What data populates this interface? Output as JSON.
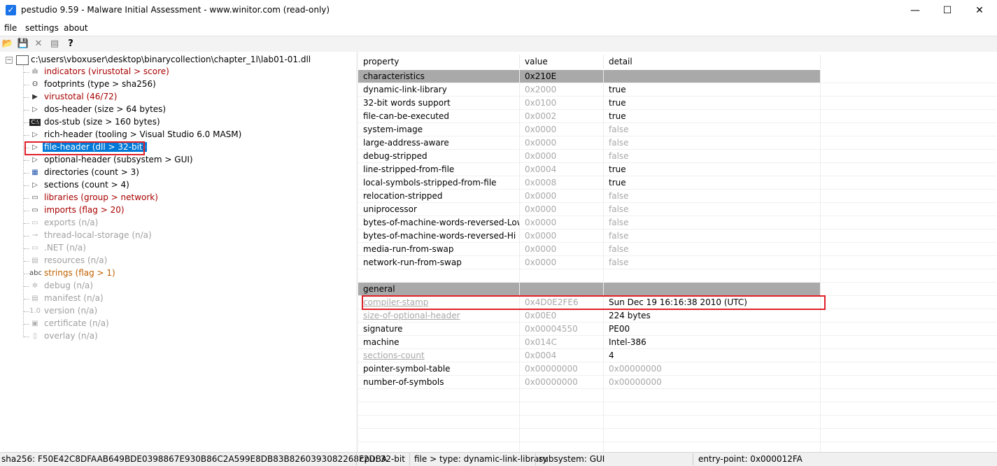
{
  "window": {
    "title": "pestudio 9.59 - Malware Initial Assessment - www.winitor.com (read-only)",
    "minimize": "—",
    "maximize": "☐",
    "close": "✕"
  },
  "menu": [
    "file",
    "settings",
    "about"
  ],
  "toolbar": {
    "icons": [
      "open-icon",
      "save-icon",
      "close-icon",
      "list-icon",
      "help-icon"
    ],
    "glyphs": [
      "📂",
      "💾",
      "✕",
      "▤",
      "?"
    ]
  },
  "tree": {
    "root": "c:\\users\\vboxuser\\desktop\\binarycollection\\chapter_1l\\lab01-01.dll",
    "expander": "−",
    "items": [
      {
        "label": "indicators (virustotal > score)",
        "style": "red",
        "icon": "indicators-icon",
        "glyph": "ılı"
      },
      {
        "label": "footprints (type > sha256)",
        "style": "normal",
        "icon": "footprints-icon",
        "glyph": "ʘ"
      },
      {
        "label": "virustotal (46/72)",
        "style": "red",
        "icon": "virustotal-icon",
        "glyph": "▶"
      },
      {
        "label": "dos-header (size > 64 bytes)",
        "style": "normal",
        "icon": "arrow-icon",
        "glyph": "▷"
      },
      {
        "label": "dos-stub (size > 160 bytes)",
        "style": "normal",
        "icon": "console-icon",
        "glyph": "C:\\"
      },
      {
        "label": "rich-header (tooling > Visual Studio 6.0 MASM)",
        "style": "normal",
        "icon": "arrow-icon",
        "glyph": "▷"
      },
      {
        "label": "file-header (dll > 32-bit)",
        "style": "selected",
        "icon": "arrow-icon",
        "glyph": "▷"
      },
      {
        "label": "optional-header (subsystem > GUI)",
        "style": "normal",
        "icon": "arrow-icon",
        "glyph": "▷"
      },
      {
        "label": "directories (count > 3)",
        "style": "normal",
        "icon": "directories-icon",
        "glyph": "▦"
      },
      {
        "label": "sections (count > 4)",
        "style": "normal",
        "icon": "arrow-icon",
        "glyph": "▷"
      },
      {
        "label": "libraries (group > network)",
        "style": "red",
        "icon": "libraries-icon",
        "glyph": "▭"
      },
      {
        "label": "imports (flag > 20)",
        "style": "red",
        "icon": "imports-icon",
        "glyph": "▭"
      },
      {
        "label": "exports (n/a)",
        "style": "gray",
        "icon": "exports-icon",
        "glyph": "▭"
      },
      {
        "label": "thread-local-storage (n/a)",
        "style": "gray",
        "icon": "tls-icon",
        "glyph": "⊸"
      },
      {
        "label": ".NET (n/a)",
        "style": "gray",
        "icon": "dotnet-icon",
        "glyph": "▭"
      },
      {
        "label": "resources (n/a)",
        "style": "gray",
        "icon": "resources-icon",
        "glyph": "▤"
      },
      {
        "label": "strings (flag > 1)",
        "style": "orange",
        "icon": "strings-icon",
        "glyph": "abc"
      },
      {
        "label": "debug (n/a)",
        "style": "gray",
        "icon": "debug-icon",
        "glyph": "✲"
      },
      {
        "label": "manifest (n/a)",
        "style": "gray",
        "icon": "manifest-icon",
        "glyph": "▤"
      },
      {
        "label": "version (n/a)",
        "style": "gray",
        "icon": "version-icon",
        "glyph": "1.0"
      },
      {
        "label": "certificate (n/a)",
        "style": "gray",
        "icon": "certificate-icon",
        "glyph": "▣"
      },
      {
        "label": "overlay (n/a)",
        "style": "gray",
        "icon": "overlay-icon",
        "glyph": "▯"
      }
    ]
  },
  "grid": {
    "headers": [
      "property",
      "value",
      "detail"
    ],
    "rows": [
      {
        "kind": "group",
        "property": "characteristics",
        "value": "0x210E",
        "detail": ""
      },
      {
        "property": "dynamic-link-library",
        "value": "0x2000",
        "detail": "true",
        "vdim": true
      },
      {
        "property": "32-bit words support",
        "value": "0x0100",
        "detail": "true",
        "vdim": true
      },
      {
        "property": "file-can-be-executed",
        "value": "0x0002",
        "detail": "true",
        "vdim": true
      },
      {
        "property": "system-image",
        "value": "0x0000",
        "detail": "false",
        "vdim": true,
        "ddim": true
      },
      {
        "property": "large-address-aware",
        "value": "0x0000",
        "detail": "false",
        "vdim": true,
        "ddim": true
      },
      {
        "property": "debug-stripped",
        "value": "0x0000",
        "detail": "false",
        "vdim": true,
        "ddim": true
      },
      {
        "property": "line-stripped-from-file",
        "value": "0x0004",
        "detail": "true",
        "vdim": true
      },
      {
        "property": "local-symbols-stripped-from-file",
        "value": "0x0008",
        "detail": "true",
        "vdim": true
      },
      {
        "property": "relocation-stripped",
        "value": "0x0000",
        "detail": "false",
        "vdim": true,
        "ddim": true
      },
      {
        "property": "uniprocessor",
        "value": "0x0000",
        "detail": "false",
        "vdim": true,
        "ddim": true
      },
      {
        "property": "bytes-of-machine-words-reversed-Low",
        "value": "0x0000",
        "detail": "false",
        "vdim": true,
        "ddim": true
      },
      {
        "property": "bytes-of-machine-words-reversed-Hi",
        "value": "0x0000",
        "detail": "false",
        "vdim": true,
        "ddim": true
      },
      {
        "property": "media-run-from-swap",
        "value": "0x0000",
        "detail": "false",
        "vdim": true,
        "ddim": true
      },
      {
        "property": "network-run-from-swap",
        "value": "0x0000",
        "detail": "false",
        "vdim": true,
        "ddim": true
      },
      {
        "kind": "blank",
        "property": "",
        "value": "",
        "detail": ""
      },
      {
        "kind": "group",
        "property": "general",
        "value": "",
        "detail": ""
      },
      {
        "property": "compiler-stamp",
        "value": "0x4D0E2FE6",
        "detail": "Sun Dec 19 16:16:38 2010 (UTC)",
        "pdim": true,
        "pul": true,
        "vdim": true
      },
      {
        "property": "size-of-optional-header",
        "value": "0x00E0",
        "detail": "224 bytes",
        "pdim": true,
        "pul": true,
        "vdim": true
      },
      {
        "property": "signature",
        "value": "0x00004550",
        "detail": "PE00",
        "vdim": true
      },
      {
        "property": "machine",
        "value": "0x014C",
        "detail": "Intel-386",
        "vdim": true
      },
      {
        "property": "sections-count",
        "value": "0x0004",
        "detail": "4",
        "pdim": true,
        "pul": true,
        "vdim": true
      },
      {
        "property": "pointer-symbol-table",
        "value": "0x00000000",
        "detail": "0x00000000",
        "vdim": true,
        "ddim": true
      },
      {
        "property": "number-of-symbols",
        "value": "0x00000000",
        "detail": "0x00000000",
        "vdim": true,
        "ddim": true
      },
      {
        "kind": "blank",
        "property": "",
        "value": "",
        "detail": ""
      },
      {
        "kind": "blank",
        "property": "",
        "value": "",
        "detail": ""
      },
      {
        "kind": "blank",
        "property": "",
        "value": "",
        "detail": ""
      },
      {
        "kind": "blank",
        "property": "",
        "value": "",
        "detail": ""
      },
      {
        "kind": "blank",
        "property": "",
        "value": "",
        "detail": ""
      }
    ]
  },
  "status": {
    "sha256": "sha256: F50E42C8DFAAB649BDE0398867E930B86C2A599E8DB83B8260393082268F2DBA",
    "cpu": "cpu: 32-bit",
    "type": "file > type: dynamic-link-library",
    "subsystem": "subsystem: GUI",
    "entry_point": "entry-point: 0x000012FA"
  },
  "colors": {
    "highlight_box": "#e0202a",
    "selection": "#0078d7",
    "group_row": "#a9a9a9",
    "red_text": "#a80000",
    "orange_text": "#c06000",
    "gray_text": "#a0a0a0"
  }
}
